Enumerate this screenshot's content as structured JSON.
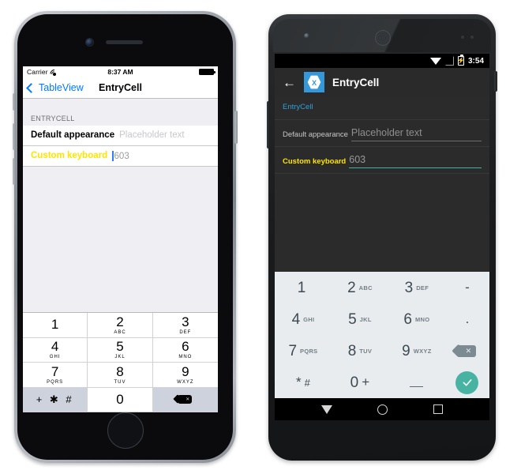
{
  "ios": {
    "status": {
      "carrier": "Carrier",
      "wifi_icon": "wifi-icon",
      "time": "8:37 AM",
      "battery_icon": "battery-icon"
    },
    "nav": {
      "back_icon": "chevron-left-icon",
      "back_label": "TableView",
      "title": "EntryCell"
    },
    "table": {
      "section_header": "ENTRYCELL",
      "rows": [
        {
          "label": "Default appearance",
          "value": "Placeholder text",
          "is_placeholder": true,
          "label_color": "#000000"
        },
        {
          "label": "Custom keyboard",
          "value": "603",
          "is_placeholder": false,
          "label_color": "#ffe400"
        }
      ]
    },
    "keypad": {
      "keys": [
        {
          "digit": "1",
          "sub": ""
        },
        {
          "digit": "2",
          "sub": "ABC"
        },
        {
          "digit": "3",
          "sub": "DEF"
        },
        {
          "digit": "4",
          "sub": "GHI"
        },
        {
          "digit": "5",
          "sub": "JKL"
        },
        {
          "digit": "6",
          "sub": "MNO"
        },
        {
          "digit": "7",
          "sub": "PQRS"
        },
        {
          "digit": "8",
          "sub": "TUV"
        },
        {
          "digit": "9",
          "sub": "WXYZ"
        }
      ],
      "symbol_key": "+ ✱ #",
      "zero_key": "0",
      "delete_icon": "backspace-icon",
      "delete_glyph": "✕"
    }
  },
  "android": {
    "status": {
      "wifi_icon": "wifi-icon",
      "signal_icon": "signal-off-icon",
      "battery_icon": "battery-charging-icon",
      "battery_glyph": "⚡",
      "time": "3:54"
    },
    "actionbar": {
      "back_icon": "arrow-left-icon",
      "back_glyph": "←",
      "logo_icon": "xamarin-logo-icon",
      "title": "EntryCell"
    },
    "content": {
      "section_header": "EntryCell",
      "rows": [
        {
          "label": "Default appearance",
          "value": "Placeholder text",
          "focused": false,
          "label_color": "#c7c7c7"
        },
        {
          "label": "Custom keyboard",
          "value": "603",
          "focused": true,
          "label_color": "#ffe400"
        }
      ]
    },
    "keypad": {
      "keys": [
        {
          "digit": "1",
          "sub": ""
        },
        {
          "digit": "2",
          "sub": "ABC"
        },
        {
          "digit": "3",
          "sub": "DEF"
        },
        {
          "digit": "4",
          "sub": "GHI"
        },
        {
          "digit": "5",
          "sub": "JKL"
        },
        {
          "digit": "6",
          "sub": "MNO"
        },
        {
          "digit": "7",
          "sub": "PQRS"
        },
        {
          "digit": "8",
          "sub": "TUV"
        },
        {
          "digit": "9",
          "sub": "WXYZ"
        }
      ],
      "star_key": "*",
      "hash_key": "#",
      "zero_key": "0",
      "plus_key": "+",
      "minus_key": "-",
      "dot_key": ".",
      "underscore_icon": "underscore-icon",
      "delete_icon": "backspace-icon",
      "delete_glyph": "✕",
      "enter_icon": "check-icon"
    },
    "navbar": {
      "back_icon": "nav-back-triangle-icon",
      "home_icon": "nav-home-circle-icon",
      "recents_icon": "nav-recents-square-icon"
    }
  },
  "colors": {
    "ios_accent": "#007aff",
    "ios_yellow": "#ffe400",
    "ios_table_bg": "#eeeef3",
    "android_accent": "#2f9fdb",
    "android_teal": "#49b3a3",
    "android_yellow": "#ffe400",
    "xamarin_blue": "#3498db"
  }
}
